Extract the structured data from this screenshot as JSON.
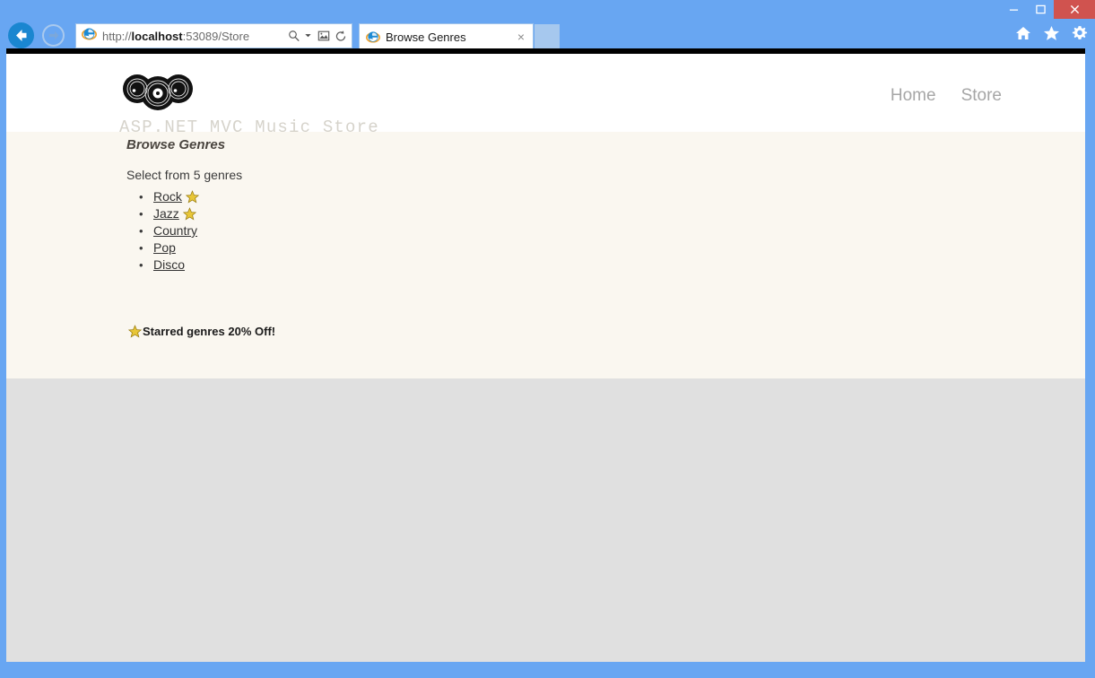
{
  "browser": {
    "nav": {
      "back_label": "Back",
      "forward_label": "Forward"
    },
    "address": {
      "url_prefix": "http://",
      "url_host": "localhost",
      "url_suffix": ":53089/Store",
      "search_icon": "search-icon",
      "dropdown_icon": "chevron-down-icon",
      "compat_icon": "compatibility-view-icon",
      "refresh_icon": "refresh-icon"
    },
    "tabs": [
      {
        "title": "Browse Genres",
        "close_label": "×",
        "favicon": "ie-favicon"
      }
    ],
    "new_tab_label": "",
    "window_controls": {
      "minimize": "–",
      "maximize": "☐",
      "close": "✕"
    },
    "command_icons": [
      {
        "name": "home-icon",
        "label": "Home"
      },
      {
        "name": "favorites-star-icon",
        "label": "Favorites"
      },
      {
        "name": "settings-gear-icon",
        "label": "Tools"
      }
    ]
  },
  "site": {
    "logo_text": "ASP.NET MVC Music Store",
    "nav_links": [
      {
        "label": "Home"
      },
      {
        "label": "Store"
      }
    ]
  },
  "page": {
    "title": "Browse Genres",
    "subtitle": "Select from 5 genres",
    "genres": [
      {
        "name": "Rock",
        "starred": true
      },
      {
        "name": "Jazz",
        "starred": true
      },
      {
        "name": "Country",
        "starred": false
      },
      {
        "name": "Pop",
        "starred": false
      },
      {
        "name": "Disco",
        "starred": false
      }
    ],
    "promo_text": "Starred genres 20% Off!"
  },
  "colors": {
    "frame_blue": "#68a6f2",
    "close_red": "#d0534f",
    "content_cream": "#faf7f0",
    "page_gray": "#e0e0e0",
    "star_gold": "#e8c637",
    "star_outline": "#9a7d10",
    "logo_gray": "#d6d3cb",
    "nav_gray": "#a6a6a6"
  }
}
